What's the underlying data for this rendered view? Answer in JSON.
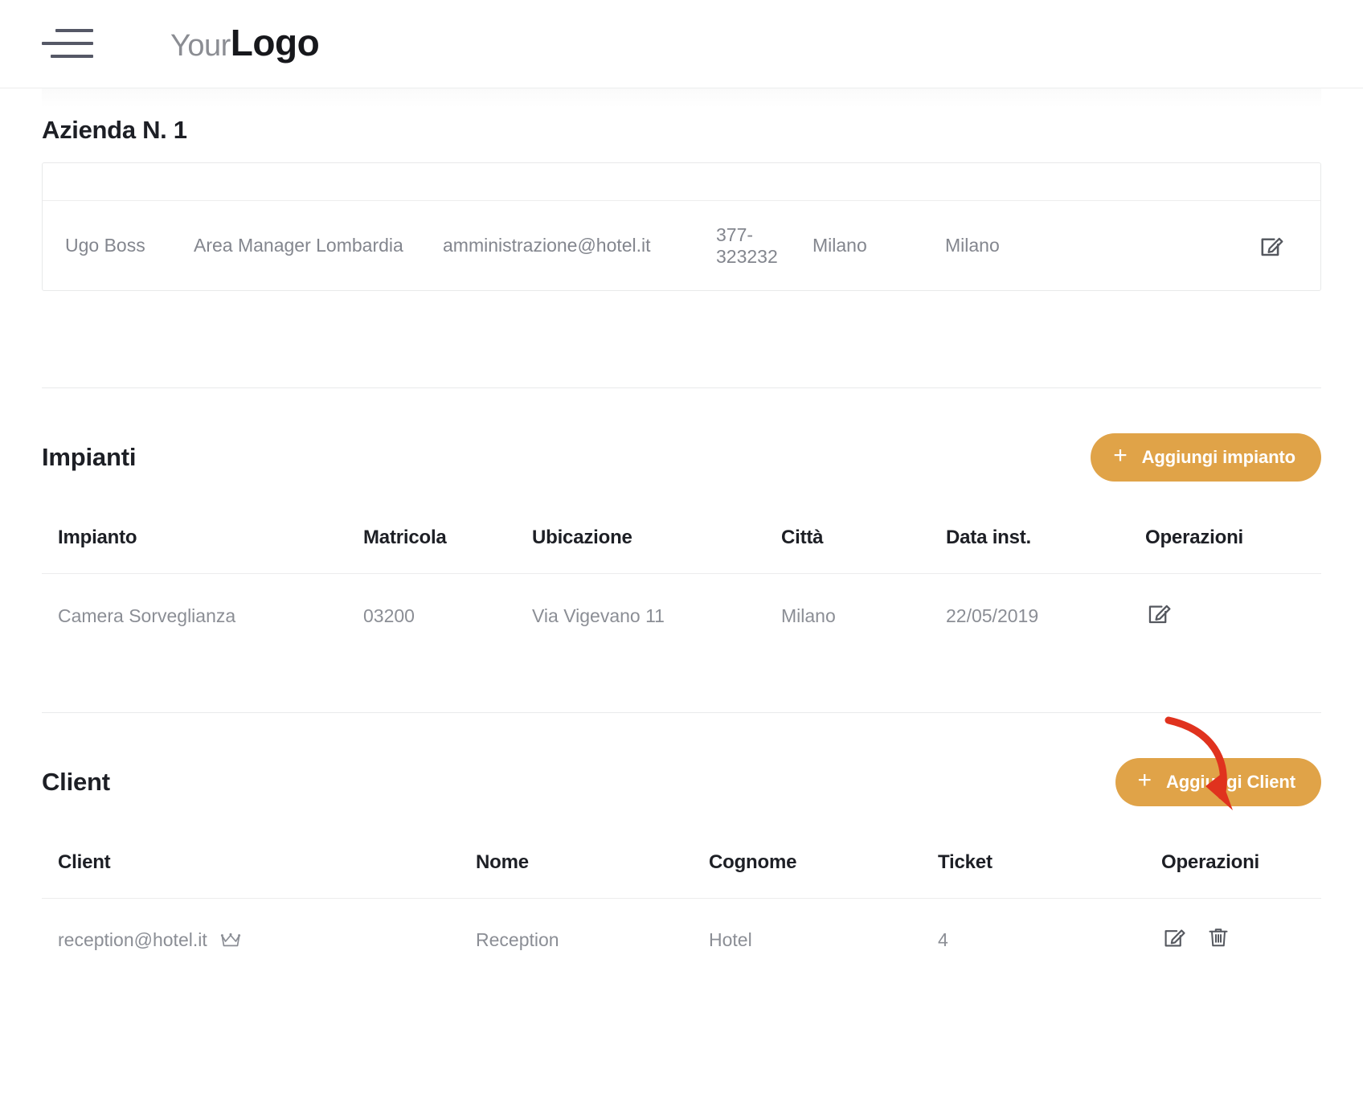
{
  "header": {
    "menu_icon": "hamburger-icon",
    "logo_first": "Your",
    "logo_second": "Logo"
  },
  "page": {
    "title": "Azienda N. 1"
  },
  "contacts_table": {
    "row": {
      "name": "Ugo Boss",
      "role": "Area Manager Lombardia",
      "email": "amministrazione@hotel.it",
      "phone": "377-323232",
      "city": "Milano",
      "province": "Milano",
      "edit_icon": "edit-icon"
    }
  },
  "impianti": {
    "title": "Impianti",
    "add_button": "Aggiungi impianto",
    "add_icon": "plus-icon",
    "columns": [
      "Impianto",
      "Matricola",
      "Ubicazione",
      "Città",
      "Data inst.",
      "Operazioni"
    ],
    "rows": [
      {
        "impianto": "Camera Sorveglianza",
        "matricola": "03200",
        "ubicazione": "Via Vigevano 11",
        "citta": "Milano",
        "data_inst": "22/05/2019",
        "edit_icon": "edit-icon"
      }
    ]
  },
  "client": {
    "title": "Client",
    "add_button": "Aggiungi Client",
    "add_icon": "plus-icon",
    "columns": [
      "Client",
      "Nome",
      "Cognome",
      "Ticket",
      "Operazioni"
    ],
    "rows": [
      {
        "client": "reception@hotel.it",
        "badge_icon": "crown-icon",
        "nome": "Reception",
        "cognome": "Hotel",
        "ticket": "4",
        "edit_icon": "edit-icon",
        "delete_icon": "trash-icon"
      }
    ]
  },
  "annotation": {
    "arrow_icon": "curved-arrow-icon",
    "arrow_color": "#e0321e",
    "points_to": "Aggiungi Client"
  },
  "colors": {
    "accent": "#e0a348",
    "text_dark": "#1d1f25",
    "text_muted": "#8b8e95",
    "border": "#ececed"
  }
}
